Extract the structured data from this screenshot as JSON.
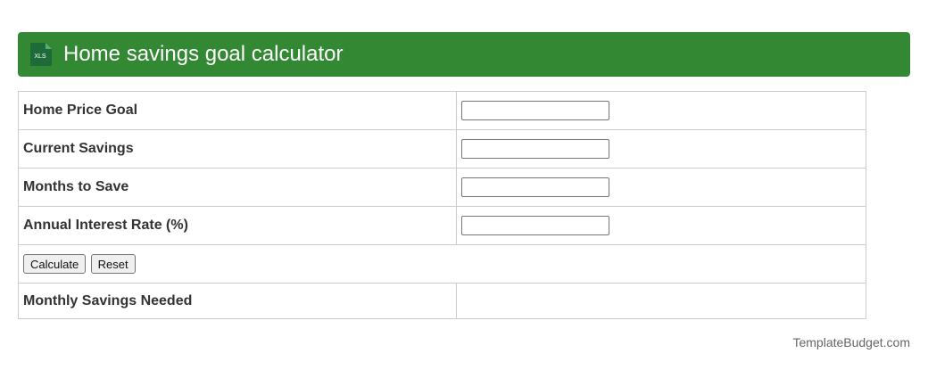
{
  "header": {
    "title": "Home savings goal calculator",
    "icon": "xls-icon",
    "icon_text": "XLS",
    "accent_color": "#338833"
  },
  "form": {
    "fields": [
      {
        "label": "Home Price Goal",
        "value": ""
      },
      {
        "label": "Current Savings",
        "value": ""
      },
      {
        "label": "Months to Save",
        "value": ""
      },
      {
        "label": "Annual Interest Rate (%)",
        "value": ""
      }
    ],
    "calculate_label": "Calculate",
    "reset_label": "Reset",
    "result_label": "Monthly Savings Needed",
    "result_value": ""
  },
  "footer": {
    "brand": "TemplateBudget.com"
  }
}
